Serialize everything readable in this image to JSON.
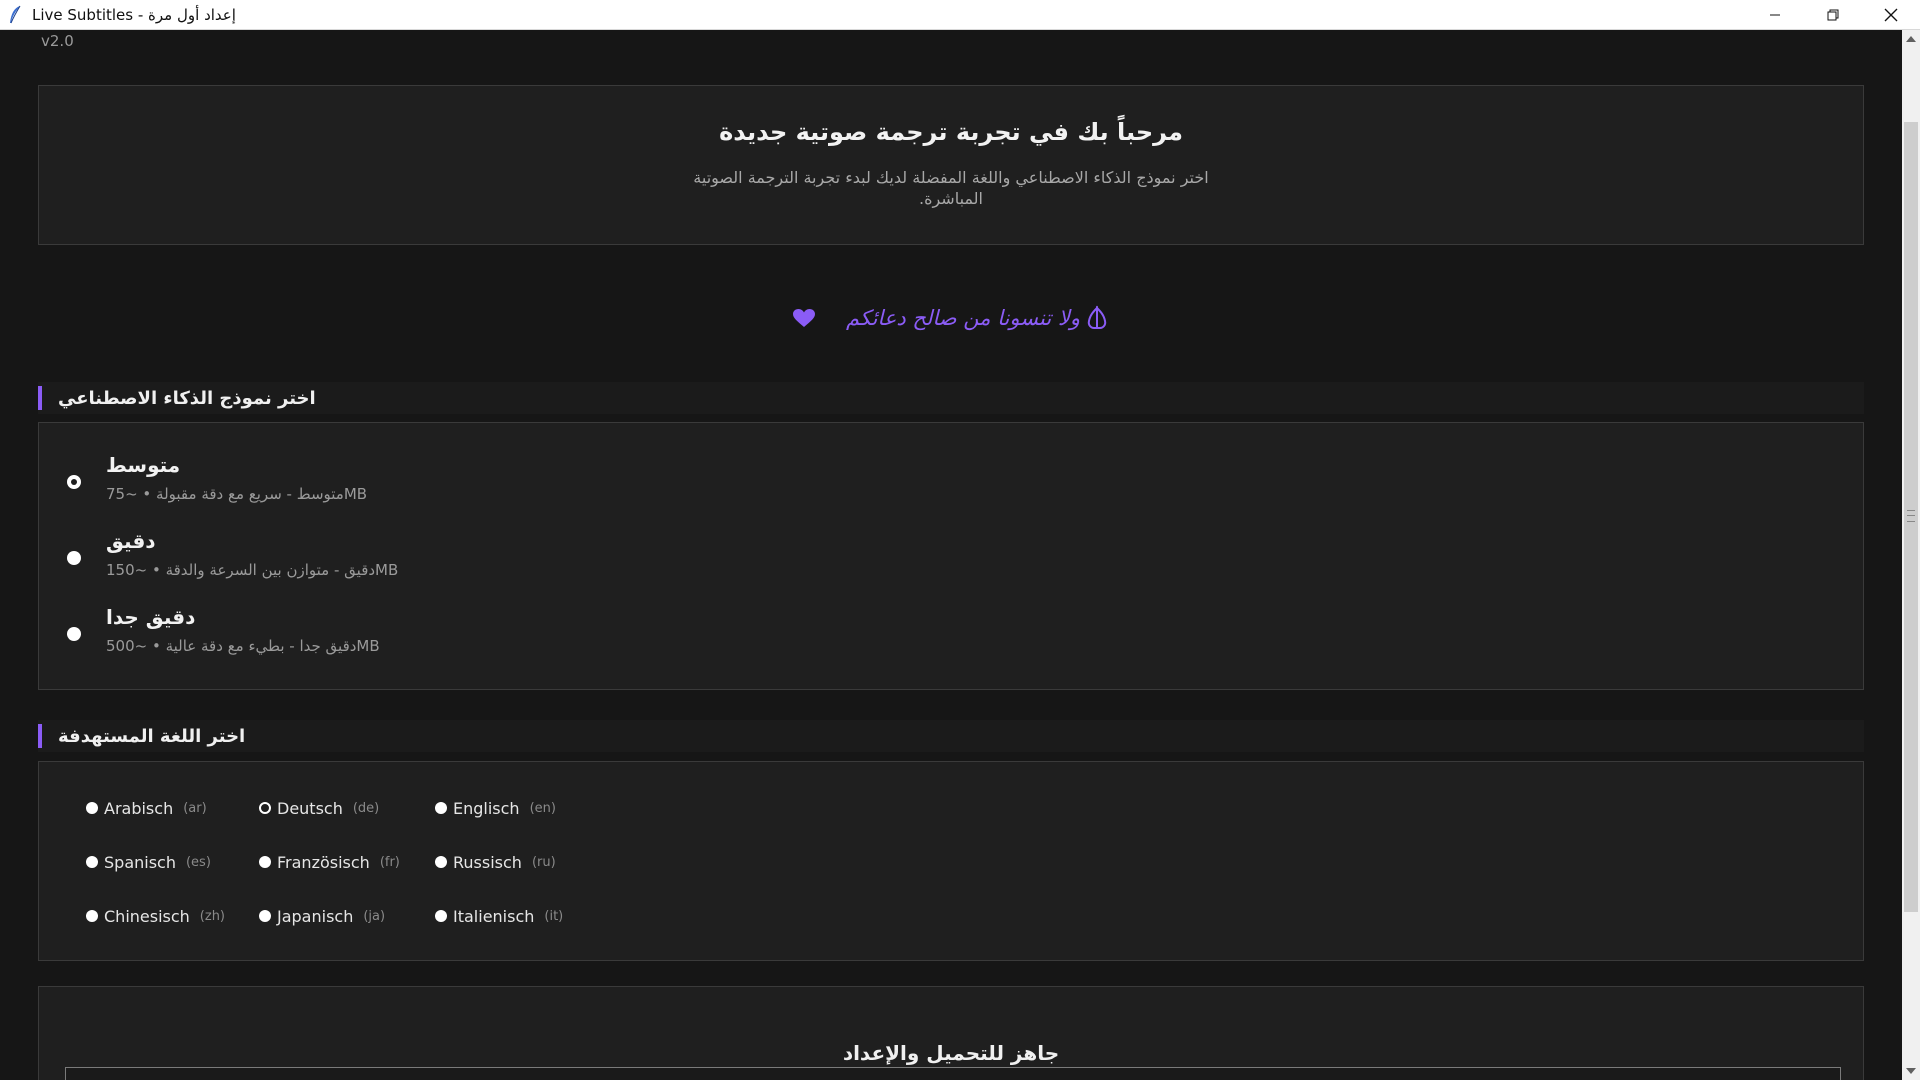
{
  "window": {
    "title": "Live Subtitles - إعداد أول مرة",
    "version": "v2.0"
  },
  "welcome": {
    "title": "مرحباً بك في تجربة ترجمة صوتية جديدة",
    "subtitle": "اختر نموذج الذكاء الاصطناعي واللغة المفضلة لديك لبدء تجربة الترجمة الصوتية المباشرة."
  },
  "dua": {
    "text": "ولا تنسونا من صالح دعائكم"
  },
  "model_section": {
    "header": "اختر نموذج الذكاء الاصطناعي",
    "options": [
      {
        "title": "متوسط",
        "desc": "متوسط - سريع مع دقة مقبولة • ~75MB",
        "selected": true
      },
      {
        "title": "دقيق",
        "desc": "دقيق - متوازن بين السرعة والدقة • ~150MB",
        "selected": false
      },
      {
        "title": "دقيق جدا",
        "desc": "دقيق جدا - بطيء مع دقة عالية • ~500MB",
        "selected": false
      }
    ]
  },
  "language_section": {
    "header": "اختر اللغة المستهدفة",
    "languages": [
      {
        "name": "Arabisch",
        "code": "(ar)",
        "selected": false
      },
      {
        "name": "Deutsch",
        "code": "(de)",
        "selected": true
      },
      {
        "name": "Englisch",
        "code": "(en)",
        "selected": false
      },
      {
        "name": "Spanisch",
        "code": "(es)",
        "selected": false
      },
      {
        "name": "Französisch",
        "code": "(fr)",
        "selected": false
      },
      {
        "name": "Russisch",
        "code": "(ru)",
        "selected": false
      },
      {
        "name": "Chinesisch",
        "code": "(zh)",
        "selected": false
      },
      {
        "name": "Japanisch",
        "code": "(ja)",
        "selected": false
      },
      {
        "name": "Italienisch",
        "code": "(it)",
        "selected": false
      }
    ]
  },
  "ready": {
    "title": "جاهز للتحميل والإعداد",
    "progress": 0
  },
  "colors": {
    "accent": "#8b5cf6",
    "background": "#161616",
    "card": "#1f1f1f"
  },
  "icons": {
    "app": "feather-icon",
    "dua_left": "heart-icon",
    "dua_right": "praying-hands-icon"
  }
}
